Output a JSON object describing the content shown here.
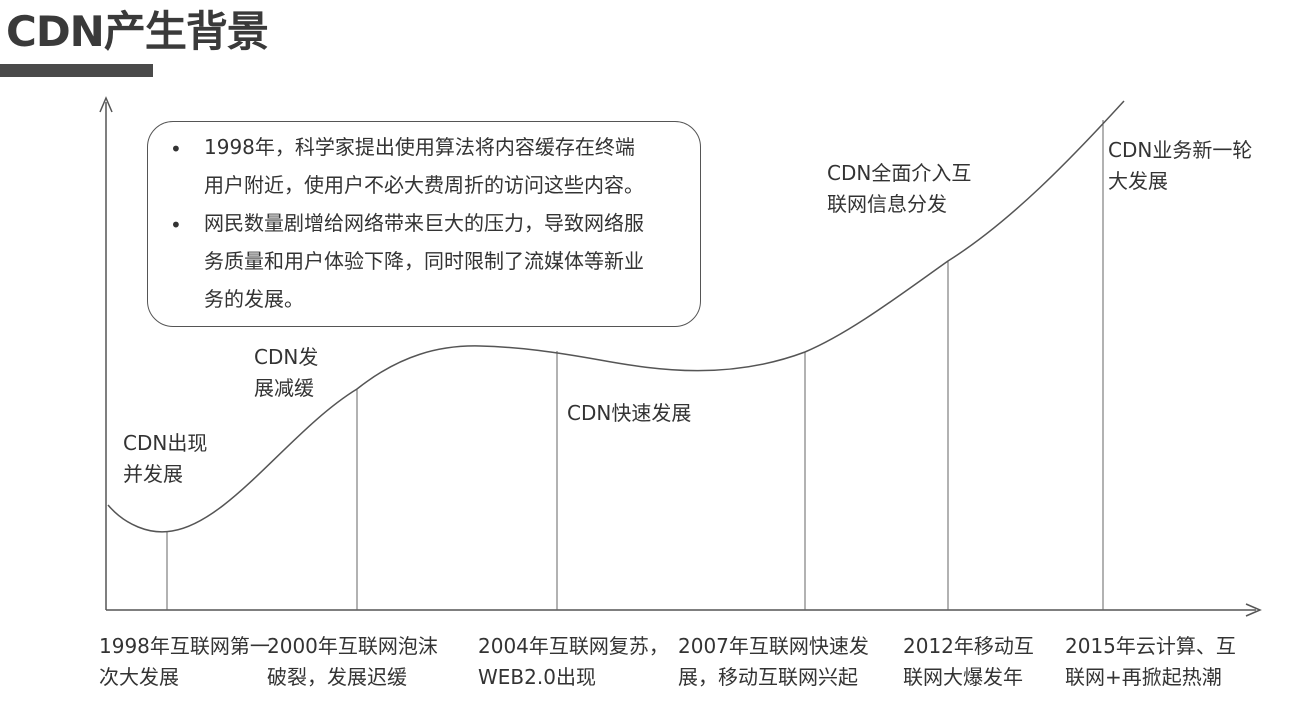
{
  "title": "CDN产生背景",
  "info_box": {
    "bullets": [
      [
        "1998年，科学家提出使用算法将内容缓存在终端",
        "用户附近，使用户不必大费周折的访问这些内容。"
      ],
      [
        "网民数量剧增给网络带来巨大的压力，导致网络服",
        "务质量和用户体验下降，同时限制了流媒体等新业",
        "务的发展。"
      ]
    ]
  },
  "stages": [
    [
      "CDN出现",
      "并发展"
    ],
    [
      "CDN发",
      "展减缓"
    ],
    [
      "CDN快速发展"
    ],
    [
      "CDN全面介入互",
      "联网信息分发"
    ],
    [
      "CDN业务新一轮",
      "大发展"
    ]
  ],
  "milestones": [
    [
      "1998年互联网第一",
      "次大发展"
    ],
    [
      "2000年互联网泡沫",
      "破裂，发展迟缓"
    ],
    [
      "2004年互联网复苏，",
      "WEB2.0出现"
    ],
    [
      "2007年互联网快速发",
      "展，移动互联网兴起"
    ],
    [
      "2012年移动互",
      "联网大爆发年"
    ],
    [
      "2015年云计算、互",
      "联网+再掀起热潮"
    ]
  ]
}
